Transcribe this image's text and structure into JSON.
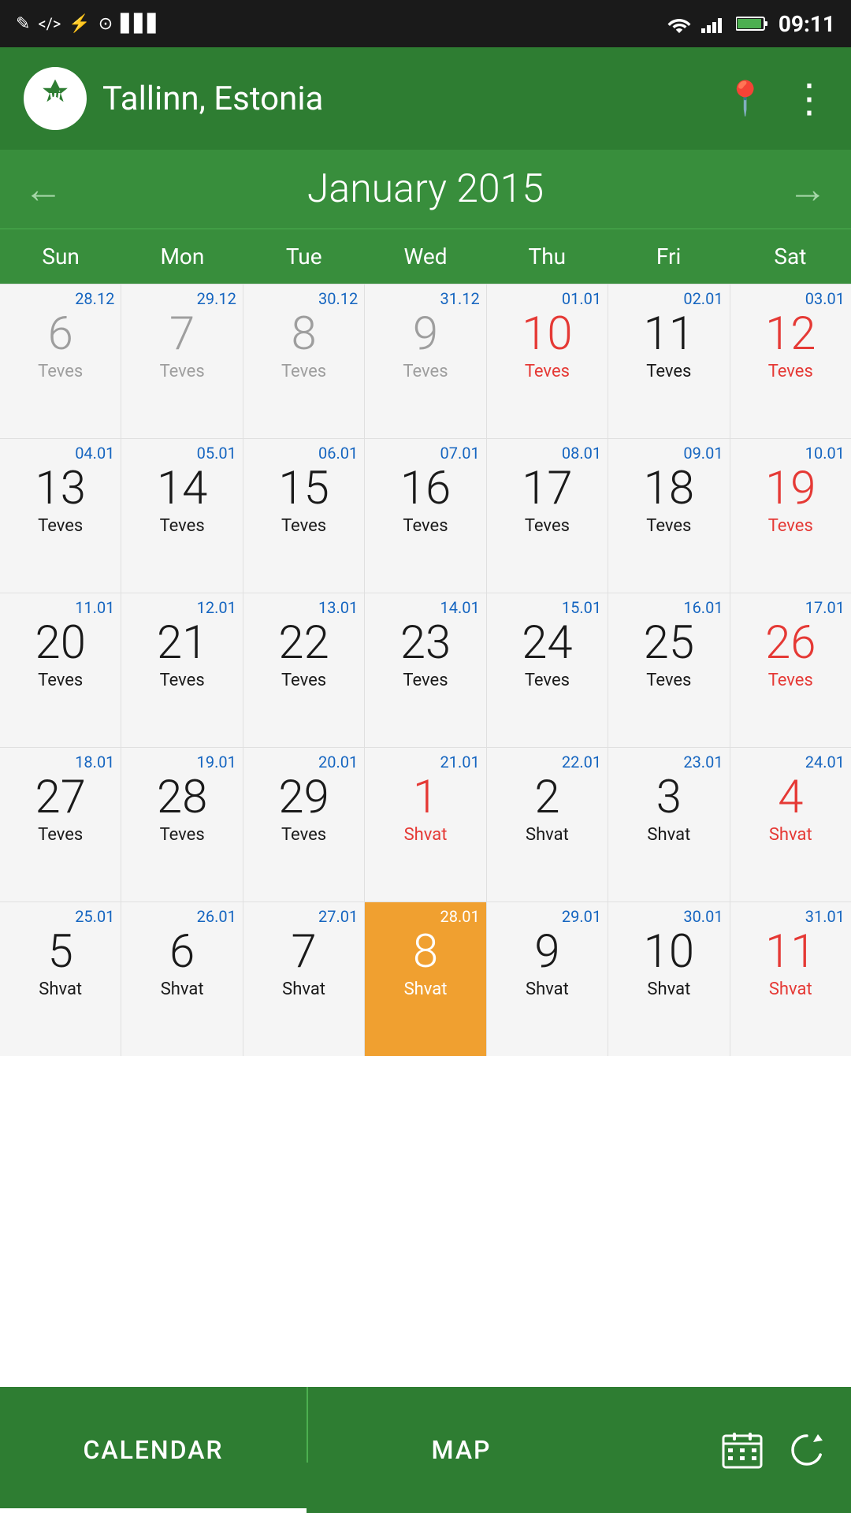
{
  "statusBar": {
    "time": "09:11",
    "leftIcons": [
      "✎",
      "</>",
      "⚡",
      "⊙",
      "▋▋▋"
    ],
    "rightIcons": [
      "wifi",
      "signal",
      "battery"
    ]
  },
  "header": {
    "location": "Tallinn, Estonia",
    "appSymbol": "שׁ"
  },
  "monthNav": {
    "title": "January 2015",
    "prevArrow": "←",
    "nextArrow": "→"
  },
  "dayHeaders": [
    "Sun",
    "Mon",
    "Tue",
    "Wed",
    "Thu",
    "Fri",
    "Sat"
  ],
  "weeks": [
    {
      "days": [
        {
          "topDate": "28.12",
          "mainDate": "6",
          "hebrew": "Teves",
          "mainColor": "gray",
          "hebrewColor": "gray",
          "topColor": "blue"
        },
        {
          "topDate": "29.12",
          "mainDate": "7",
          "hebrew": "Teves",
          "mainColor": "gray",
          "hebrewColor": "gray",
          "topColor": "blue"
        },
        {
          "topDate": "30.12",
          "mainDate": "8",
          "hebrew": "Teves",
          "mainColor": "gray",
          "hebrewColor": "gray",
          "topColor": "blue"
        },
        {
          "topDate": "31.12",
          "mainDate": "9",
          "hebrew": "Teves",
          "mainColor": "gray",
          "hebrewColor": "gray",
          "topColor": "blue"
        },
        {
          "topDate": "01.01",
          "mainDate": "10",
          "hebrew": "Teves",
          "mainColor": "red",
          "hebrewColor": "red",
          "topColor": "blue"
        },
        {
          "topDate": "02.01",
          "mainDate": "11",
          "hebrew": "Teves",
          "mainColor": "black",
          "hebrewColor": "black",
          "topColor": "blue"
        },
        {
          "topDate": "03.01",
          "mainDate": "12",
          "hebrew": "Teves",
          "mainColor": "red",
          "hebrewColor": "red",
          "topColor": "blue"
        }
      ]
    },
    {
      "days": [
        {
          "topDate": "04.01",
          "mainDate": "13",
          "hebrew": "Teves",
          "mainColor": "black",
          "hebrewColor": "black",
          "topColor": "blue"
        },
        {
          "topDate": "05.01",
          "mainDate": "14",
          "hebrew": "Teves",
          "mainColor": "black",
          "hebrewColor": "black",
          "topColor": "blue"
        },
        {
          "topDate": "06.01",
          "mainDate": "15",
          "hebrew": "Teves",
          "mainColor": "black",
          "hebrewColor": "black",
          "topColor": "blue"
        },
        {
          "topDate": "07.01",
          "mainDate": "16",
          "hebrew": "Teves",
          "mainColor": "black",
          "hebrewColor": "black",
          "topColor": "blue"
        },
        {
          "topDate": "08.01",
          "mainDate": "17",
          "hebrew": "Teves",
          "mainColor": "black",
          "hebrewColor": "black",
          "topColor": "blue"
        },
        {
          "topDate": "09.01",
          "mainDate": "18",
          "hebrew": "Teves",
          "mainColor": "black",
          "hebrewColor": "black",
          "topColor": "blue"
        },
        {
          "topDate": "10.01",
          "mainDate": "19",
          "hebrew": "Teves",
          "mainColor": "red",
          "hebrewColor": "red",
          "topColor": "blue"
        }
      ]
    },
    {
      "days": [
        {
          "topDate": "11.01",
          "mainDate": "20",
          "hebrew": "Teves",
          "mainColor": "black",
          "hebrewColor": "black",
          "topColor": "blue"
        },
        {
          "topDate": "12.01",
          "mainDate": "21",
          "hebrew": "Teves",
          "mainColor": "black",
          "hebrewColor": "black",
          "topColor": "blue"
        },
        {
          "topDate": "13.01",
          "mainDate": "22",
          "hebrew": "Teves",
          "mainColor": "black",
          "hebrewColor": "black",
          "topColor": "blue"
        },
        {
          "topDate": "14.01",
          "mainDate": "23",
          "hebrew": "Teves",
          "mainColor": "black",
          "hebrewColor": "black",
          "topColor": "blue"
        },
        {
          "topDate": "15.01",
          "mainDate": "24",
          "hebrew": "Teves",
          "mainColor": "black",
          "hebrewColor": "black",
          "topColor": "blue"
        },
        {
          "topDate": "16.01",
          "mainDate": "25",
          "hebrew": "Teves",
          "mainColor": "black",
          "hebrewColor": "black",
          "topColor": "blue"
        },
        {
          "topDate": "17.01",
          "mainDate": "26",
          "hebrew": "Teves",
          "mainColor": "red",
          "hebrewColor": "red",
          "topColor": "blue"
        }
      ]
    },
    {
      "days": [
        {
          "topDate": "18.01",
          "mainDate": "27",
          "hebrew": "Teves",
          "mainColor": "black",
          "hebrewColor": "black",
          "topColor": "blue"
        },
        {
          "topDate": "19.01",
          "mainDate": "28",
          "hebrew": "Teves",
          "mainColor": "black",
          "hebrewColor": "black",
          "topColor": "blue"
        },
        {
          "topDate": "20.01",
          "mainDate": "29",
          "hebrew": "Teves",
          "mainColor": "black",
          "hebrewColor": "black",
          "topColor": "blue"
        },
        {
          "topDate": "21.01",
          "mainDate": "1",
          "hebrew": "Shvat",
          "mainColor": "red",
          "hebrewColor": "red",
          "topColor": "blue"
        },
        {
          "topDate": "22.01",
          "mainDate": "2",
          "hebrew": "Shvat",
          "mainColor": "black",
          "hebrewColor": "black",
          "topColor": "blue"
        },
        {
          "topDate": "23.01",
          "mainDate": "3",
          "hebrew": "Shvat",
          "mainColor": "black",
          "hebrewColor": "black",
          "topColor": "blue"
        },
        {
          "topDate": "24.01",
          "mainDate": "4",
          "hebrew": "Shvat",
          "mainColor": "red",
          "hebrewColor": "red",
          "topColor": "blue"
        }
      ]
    },
    {
      "days": [
        {
          "topDate": "25.01",
          "mainDate": "5",
          "hebrew": "Shvat",
          "mainColor": "black",
          "hebrewColor": "black",
          "topColor": "blue"
        },
        {
          "topDate": "26.01",
          "mainDate": "6",
          "hebrew": "Shvat",
          "mainColor": "black",
          "hebrewColor": "black",
          "topColor": "blue"
        },
        {
          "topDate": "27.01",
          "mainDate": "7",
          "hebrew": "Shvat",
          "mainColor": "black",
          "hebrewColor": "black",
          "topColor": "blue"
        },
        {
          "topDate": "28.01",
          "mainDate": "8",
          "hebrew": "Shvat",
          "mainColor": "today",
          "hebrewColor": "today",
          "topColor": "blue",
          "today": true
        },
        {
          "topDate": "29.01",
          "mainDate": "9",
          "hebrew": "Shvat",
          "mainColor": "black",
          "hebrewColor": "black",
          "topColor": "blue"
        },
        {
          "topDate": "30.01",
          "mainDate": "10",
          "hebrew": "Shvat",
          "mainColor": "black",
          "hebrewColor": "black",
          "topColor": "blue"
        },
        {
          "topDate": "31.01",
          "mainDate": "11",
          "hebrew": "Shvat",
          "mainColor": "red",
          "hebrewColor": "red",
          "topColor": "blue"
        }
      ]
    }
  ],
  "bottomNav": {
    "tabs": [
      {
        "label": "CALENDAR",
        "active": true
      },
      {
        "label": "MAP",
        "active": false
      }
    ],
    "rightIcons": [
      "calendar-icon",
      "refresh-icon"
    ]
  }
}
